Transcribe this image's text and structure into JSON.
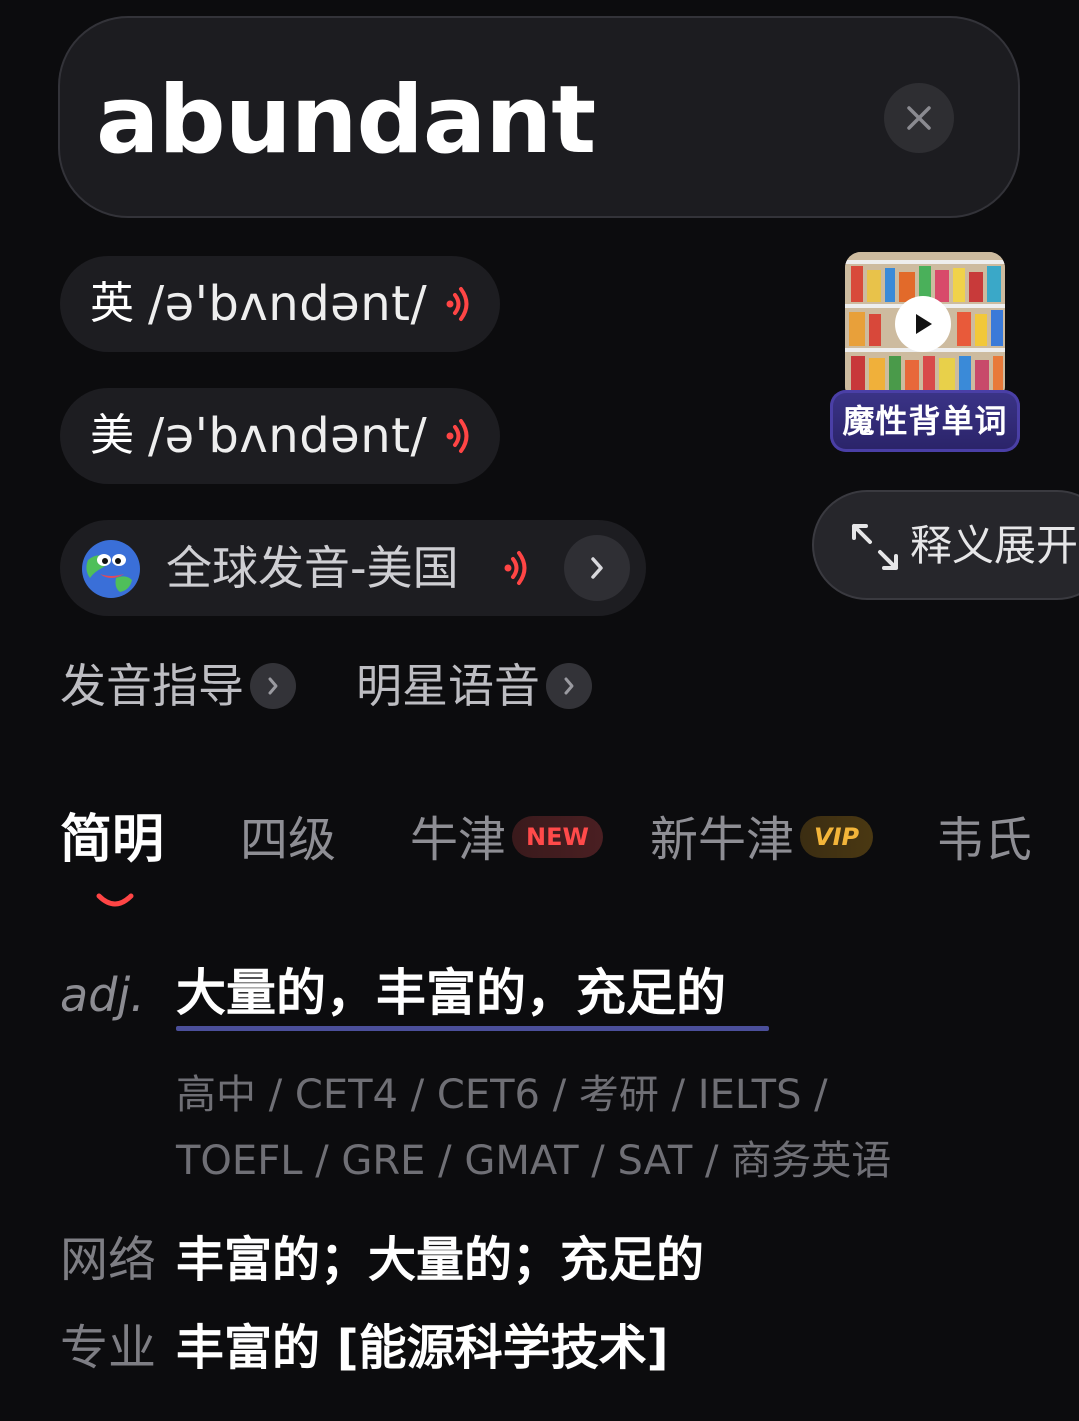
{
  "search": {
    "word": "abundant"
  },
  "pronunciations": [
    {
      "region": "英",
      "ipa": "/ə'bʌndənt/"
    },
    {
      "region": "美",
      "ipa": "/ə'bʌndənt/"
    }
  ],
  "global_pronunciation": {
    "label": "全球发音-美国"
  },
  "video_card": {
    "label": "魔性背单词"
  },
  "expand_button": {
    "label": "释义展开"
  },
  "guide_links": [
    {
      "label": "发音指导"
    },
    {
      "label": "明星语音"
    }
  ],
  "tabs": [
    {
      "label": "简明",
      "active": true
    },
    {
      "label": "四级"
    },
    {
      "label": "牛津",
      "badge": "NEW"
    },
    {
      "label": "新牛津",
      "badge": "VIP"
    },
    {
      "label": "韦氏"
    }
  ],
  "definition": {
    "pos": "adj.",
    "meaning": "大量的，丰富的，充足的",
    "exam_tags_line1": "高中 / CET4 / CET6 / 考研 / IELTS /",
    "exam_tags_line2": "TOEFL / GRE / GMAT / SAT / 商务英语"
  },
  "extra_defs": [
    {
      "label": "网络",
      "text": "丰富的；大量的；充足的"
    },
    {
      "label": "专业",
      "text": "丰富的 [能源科学技术]"
    }
  ],
  "colors": {
    "background": "#0c0c0e",
    "accent_red": "#ff4545",
    "underline": "#4b4f9a",
    "vip_gold": "#f3b53a"
  }
}
